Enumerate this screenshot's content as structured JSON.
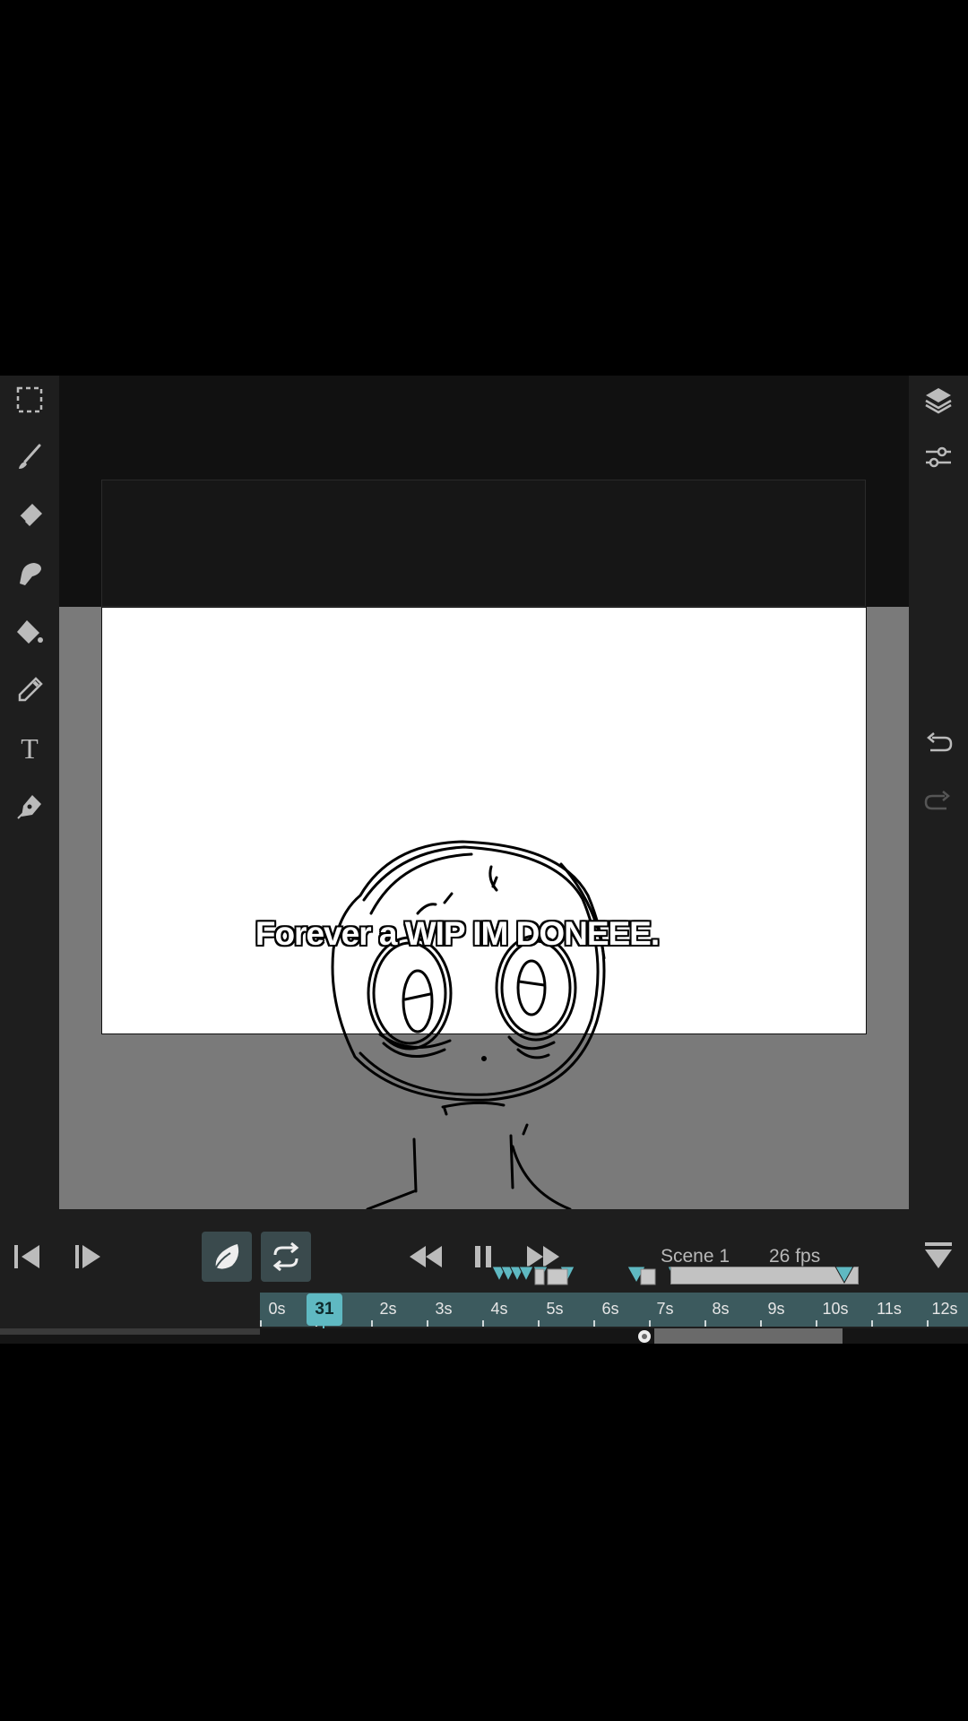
{
  "canvas": {
    "caption": "Forever a WIP IM DONEEE."
  },
  "left_toolbar": {
    "tools": [
      "selection-icon",
      "brush-icon",
      "eraser-icon",
      "smudge-icon",
      "fill-icon",
      "eyedropper-icon",
      "text-icon",
      "pen-icon"
    ]
  },
  "right_toolbar": {
    "tools": [
      "layers-icon",
      "adjustments-icon",
      "undo-icon",
      "redo-icon"
    ]
  },
  "playback": {
    "scene_label": "Scene 1",
    "fps_label": "26 fps",
    "onion_skin_active": true,
    "loop_active": true,
    "state": "playing"
  },
  "timeline": {
    "current_frame": "31",
    "tick_labels": [
      "0s",
      "2s",
      "3s",
      "4s",
      "5s",
      "6s",
      "7s",
      "8s",
      "9s",
      "10s",
      "11s",
      "12s"
    ],
    "accent": "#5fb9c2"
  }
}
